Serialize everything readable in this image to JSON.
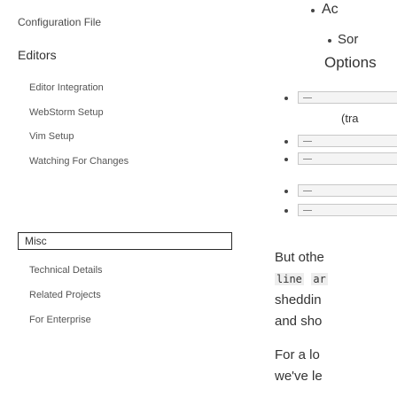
{
  "sidebar": {
    "top_item": "Configuration File",
    "editors_heading": "Editors",
    "editors_items": [
      "Editor Integration",
      "WebStorm Setup",
      "Vim Setup",
      "Watching For Changes"
    ],
    "misc_label": "Misc",
    "misc_items": [
      "Technical Details",
      "Related Projects",
      "For Enterprise"
    ]
  },
  "content": {
    "top_bullet_text": "Ac",
    "sub_bullet_text": "Sor",
    "options_heading": "Options",
    "thumb_caption": "(tra",
    "para1_line1": "But othe",
    "para1_code1": "line",
    "para1_code2": "ar",
    "para1_line3": "sheddin",
    "para1_line4": "and sho",
    "para2_line1": "For a lo",
    "para2_line2": "we've le"
  }
}
